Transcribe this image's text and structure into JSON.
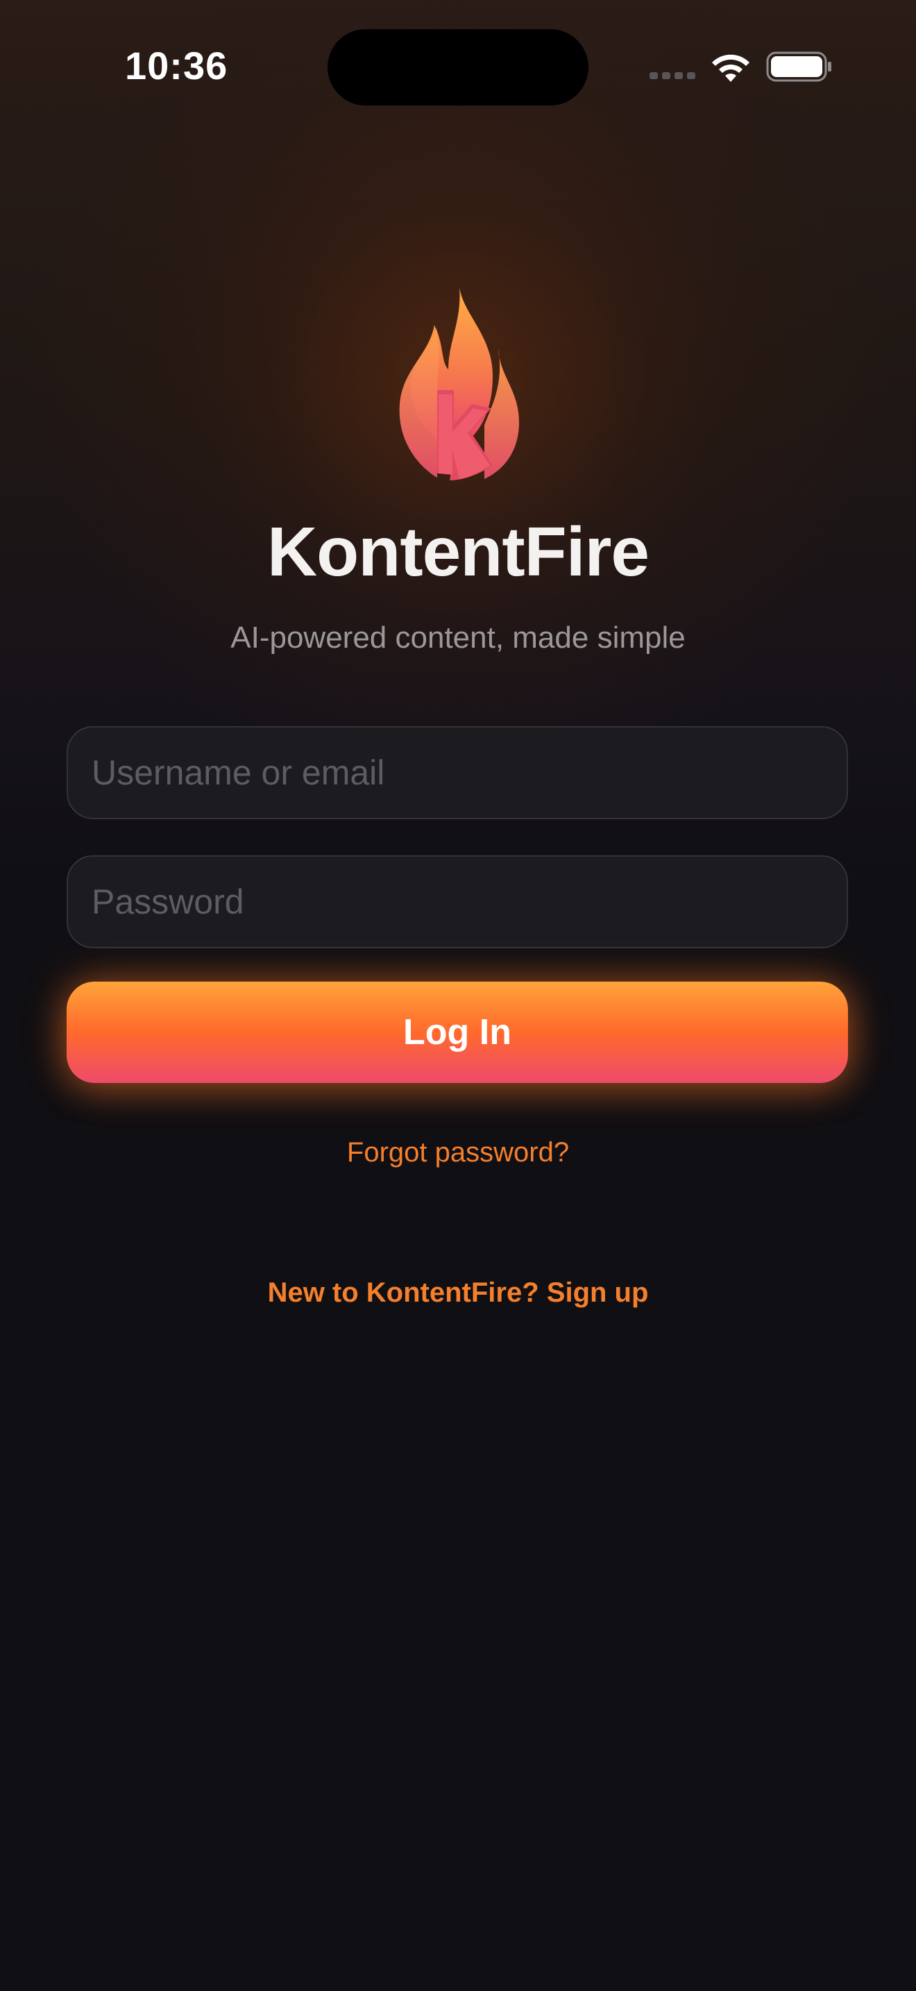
{
  "status_bar": {
    "time": "10:36",
    "signal_icon": "cellular-signal-icon",
    "wifi_icon": "wifi-icon",
    "battery_icon": "battery-icon"
  },
  "brand": {
    "logo_icon": "flame-logo-icon",
    "app_name": "KontentFire",
    "tagline": "AI-powered content, made simple"
  },
  "login_form": {
    "username_placeholder": "Username or email",
    "username_value": "",
    "password_placeholder": "Password",
    "password_value": "",
    "login_label": "Log In",
    "forgot_password_label": "Forgot password?",
    "signup_label": "New to KontentFire? Sign up"
  },
  "colors": {
    "background": "#100f13",
    "accent": "#f47f2c",
    "button_gradient_top": "#ffa33a",
    "button_gradient_bottom": "#ee4a6c",
    "field_background": "#1c1b20"
  }
}
